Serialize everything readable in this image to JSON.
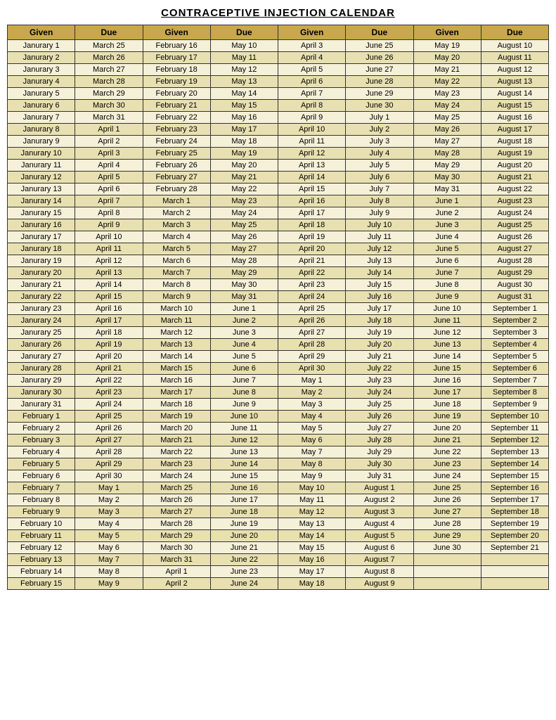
{
  "title": "CONTRACEPTIVE INJECTION CALENDAR",
  "columns": [
    {
      "given": "Given",
      "due": "Due"
    },
    {
      "given": "Given",
      "due": "Due"
    },
    {
      "given": "Given",
      "due": "Due"
    },
    {
      "given": "Given",
      "due": "Due"
    }
  ],
  "rows": [
    [
      "Janurary 1",
      "March 25",
      "February 16",
      "May 10",
      "April 3",
      "June 25",
      "May 19",
      "August 10"
    ],
    [
      "Janurary 2",
      "March 26",
      "February 17",
      "May 11",
      "April 4",
      "June 26",
      "May 20",
      "August 11"
    ],
    [
      "Janurary 3",
      "March 27",
      "February 18",
      "May 12",
      "April 5",
      "June 27",
      "May 21",
      "August 12"
    ],
    [
      "Janurary 4",
      "March 28",
      "February 19",
      "May 13",
      "April 6",
      "June 28",
      "May 22",
      "August 13"
    ],
    [
      "Janurary 5",
      "March 29",
      "February 20",
      "May 14",
      "April 7",
      "June 29",
      "May 23",
      "August 14"
    ],
    [
      "Janurary 6",
      "March 30",
      "February 21",
      "May 15",
      "April 8",
      "June 30",
      "May 24",
      "August 15"
    ],
    [
      "Janurary 7",
      "March 31",
      "February 22",
      "May 16",
      "April 9",
      "July 1",
      "May 25",
      "August 16"
    ],
    [
      "Janurary 8",
      "April 1",
      "February 23",
      "May 17",
      "April 10",
      "July 2",
      "May 26",
      "August 17"
    ],
    [
      "Janurary 9",
      "April 2",
      "February 24",
      "May 18",
      "April 11",
      "July 3",
      "May 27",
      "August 18"
    ],
    [
      "Janurary 10",
      "April 3",
      "February 25",
      "May 19",
      "April 12",
      "July 4",
      "May 28",
      "August 19"
    ],
    [
      "Janurary 11",
      "April 4",
      "February 26",
      "May 20",
      "April 13",
      "July 5",
      "May 29",
      "August 20"
    ],
    [
      "Janurary 12",
      "April 5",
      "February 27",
      "May 21",
      "April 14",
      "July 6",
      "May 30",
      "August 21"
    ],
    [
      "Janurary 13",
      "April 6",
      "February 28",
      "May 22",
      "April 15",
      "July 7",
      "May 31",
      "August 22"
    ],
    [
      "Janurary 14",
      "April 7",
      "March 1",
      "May 23",
      "April 16",
      "July 8",
      "June 1",
      "August 23"
    ],
    [
      "Janurary 15",
      "April 8",
      "March 2",
      "May 24",
      "April 17",
      "July 9",
      "June 2",
      "August 24"
    ],
    [
      "Janurary 16",
      "April 9",
      "March 3",
      "May 25",
      "April 18",
      "July 10",
      "June 3",
      "August 25"
    ],
    [
      "Janurary 17",
      "April 10",
      "March 4",
      "May 26",
      "April 19",
      "July 11",
      "June 4",
      "August 26"
    ],
    [
      "Janurary 18",
      "April 11",
      "March 5",
      "May 27",
      "April 20",
      "July 12",
      "June 5",
      "August 27"
    ],
    [
      "Janurary 19",
      "April 12",
      "March 6",
      "May 28",
      "April 21",
      "July 13",
      "June 6",
      "August 28"
    ],
    [
      "Janurary 20",
      "April 13",
      "March 7",
      "May 29",
      "April 22",
      "July 14",
      "June 7",
      "August 29"
    ],
    [
      "Janurary 21",
      "April 14",
      "March 8",
      "May 30",
      "April 23",
      "July 15",
      "June 8",
      "August 30"
    ],
    [
      "Janurary 22",
      "April 15",
      "March 9",
      "May 31",
      "April 24",
      "July 16",
      "June 9",
      "August 31"
    ],
    [
      "Janurary 23",
      "April 16",
      "March 10",
      "June 1",
      "April 25",
      "July 17",
      "June 10",
      "September 1"
    ],
    [
      "Janurary 24",
      "April 17",
      "March 11",
      "June 2",
      "April 26",
      "July 18",
      "June 11",
      "September 2"
    ],
    [
      "Janurary 25",
      "April 18",
      "March 12",
      "June 3",
      "April 27",
      "July 19",
      "June 12",
      "September 3"
    ],
    [
      "Janurary 26",
      "April 19",
      "March 13",
      "June 4",
      "April 28",
      "July 20",
      "June 13",
      "September 4"
    ],
    [
      "Janurary 27",
      "April 20",
      "March 14",
      "June 5",
      "April 29",
      "July 21",
      "June 14",
      "September 5"
    ],
    [
      "Janurary 28",
      "April 21",
      "March 15",
      "June 6",
      "April 30",
      "July 22",
      "June 15",
      "September 6"
    ],
    [
      "Janurary 29",
      "April 22",
      "March 16",
      "June 7",
      "May 1",
      "July 23",
      "June 16",
      "September 7"
    ],
    [
      "Janurary 30",
      "April 23",
      "March 17",
      "June 8",
      "May 2",
      "July 24",
      "June 17",
      "September 8"
    ],
    [
      "Janurary 31",
      "April 24",
      "March 18",
      "June 9",
      "May 3",
      "July 25",
      "June 18",
      "September 9"
    ],
    [
      "February 1",
      "April 25",
      "March 19",
      "June 10",
      "May 4",
      "July 26",
      "June 19",
      "September 10"
    ],
    [
      "February 2",
      "April 26",
      "March 20",
      "June 11",
      "May 5",
      "July 27",
      "June 20",
      "September 11"
    ],
    [
      "February 3",
      "April 27",
      "March 21",
      "June 12",
      "May 6",
      "July 28",
      "June 21",
      "September 12"
    ],
    [
      "February 4",
      "April 28",
      "March 22",
      "June 13",
      "May 7",
      "July 29",
      "June 22",
      "September 13"
    ],
    [
      "February 5",
      "April 29",
      "March 23",
      "June 14",
      "May 8",
      "July 30",
      "June 23",
      "September 14"
    ],
    [
      "February 6",
      "April 30",
      "March 24",
      "June 15",
      "May 9",
      "July 31",
      "June 24",
      "September 15"
    ],
    [
      "February 7",
      "May 1",
      "March 25",
      "June 16",
      "May 10",
      "August 1",
      "June 25",
      "September 16"
    ],
    [
      "February 8",
      "May 2",
      "March 26",
      "June 17",
      "May 11",
      "August 2",
      "June 26",
      "September 17"
    ],
    [
      "February 9",
      "May 3",
      "March 27",
      "June 18",
      "May 12",
      "August 3",
      "June 27",
      "September 18"
    ],
    [
      "February 10",
      "May 4",
      "March 28",
      "June 19",
      "May 13",
      "August 4",
      "June 28",
      "September 19"
    ],
    [
      "February 11",
      "May 5",
      "March 29",
      "June 20",
      "May 14",
      "August 5",
      "June 29",
      "September 20"
    ],
    [
      "February 12",
      "May 6",
      "March 30",
      "June 21",
      "May 15",
      "August 6",
      "June 30",
      "September 21"
    ],
    [
      "February 13",
      "May 7",
      "March 31",
      "June 22",
      "May 16",
      "August 7",
      "",
      ""
    ],
    [
      "February 14",
      "May 8",
      "April 1",
      "June 23",
      "May 17",
      "August 8",
      "",
      ""
    ],
    [
      "February 15",
      "May 9",
      "April 2",
      "June 24",
      "May 18",
      "August 9",
      "",
      ""
    ]
  ]
}
